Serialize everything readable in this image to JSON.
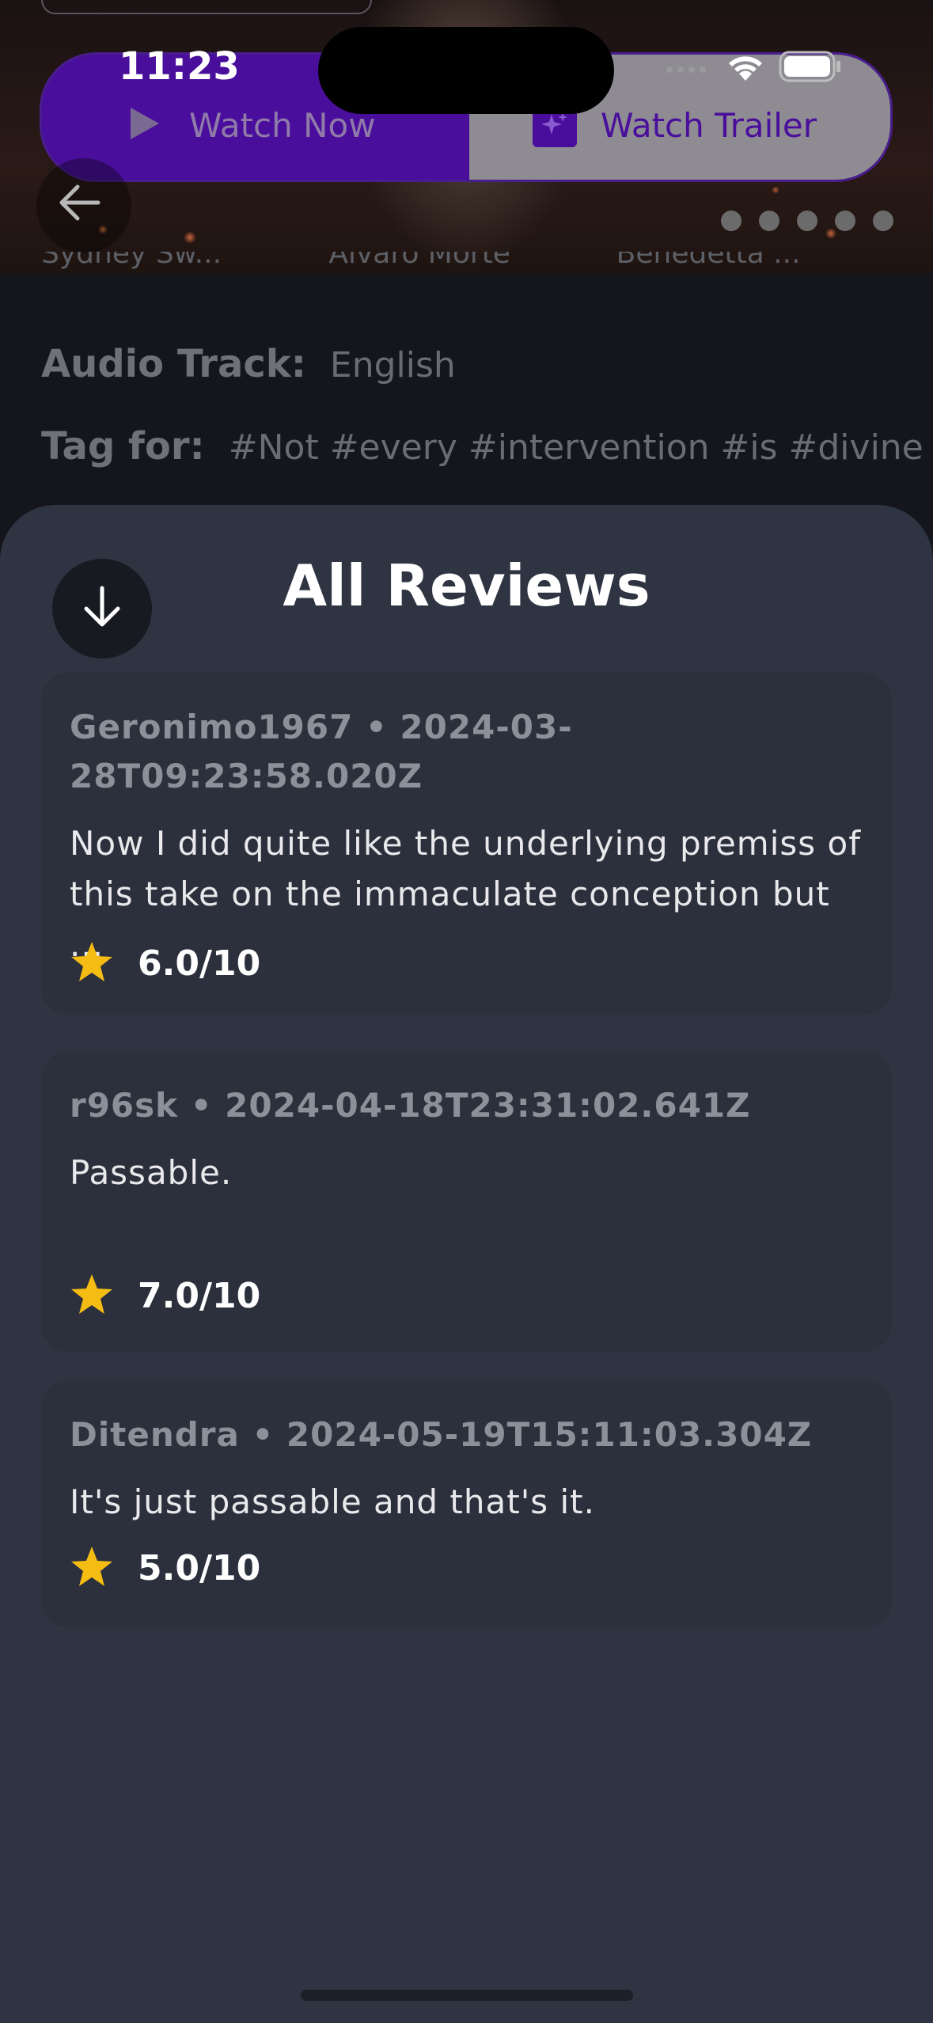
{
  "status_bar": {
    "time": "11:23"
  },
  "actions": {
    "watch_now_label": "Watch Now",
    "watch_trailer_label": "Watch Trailer"
  },
  "hero": {
    "page_count": 5
  },
  "cast": [
    "Sydney Sw...",
    "Álvaro Morte",
    "Benedetta ..."
  ],
  "details": {
    "audio_label": "Audio Track:",
    "audio_value": "English",
    "tags_label": "Tag for:",
    "tags_value": "#Not #every #intervention #is #divine"
  },
  "reviews_sheet": {
    "title": "All Reviews",
    "reviews": [
      {
        "meta": "Geronimo1967 • 2024-03-28T09:23:58.020Z",
        "text": "Now I did quite like the underlying premiss of this take on the immaculate conception but ...",
        "rating": "6.0/10"
      },
      {
        "meta": "r96sk • 2024-04-18T23:31:02.641Z",
        "text": "Passable.",
        "rating": "7.0/10"
      },
      {
        "meta": "Ditendra • 2024-05-19T15:11:03.304Z",
        "text": "It's just passable and that's it.",
        "rating": "5.0/10"
      }
    ]
  },
  "colors": {
    "accent_purple": "#4a0e9c",
    "star": "#f5bd14",
    "sheet_background": "#2f3443"
  },
  "icons": [
    "play-icon",
    "sparkle-icon",
    "wifi-icon",
    "battery-icon",
    "back-arrow-icon",
    "arrow-down-icon",
    "star-icon"
  ]
}
